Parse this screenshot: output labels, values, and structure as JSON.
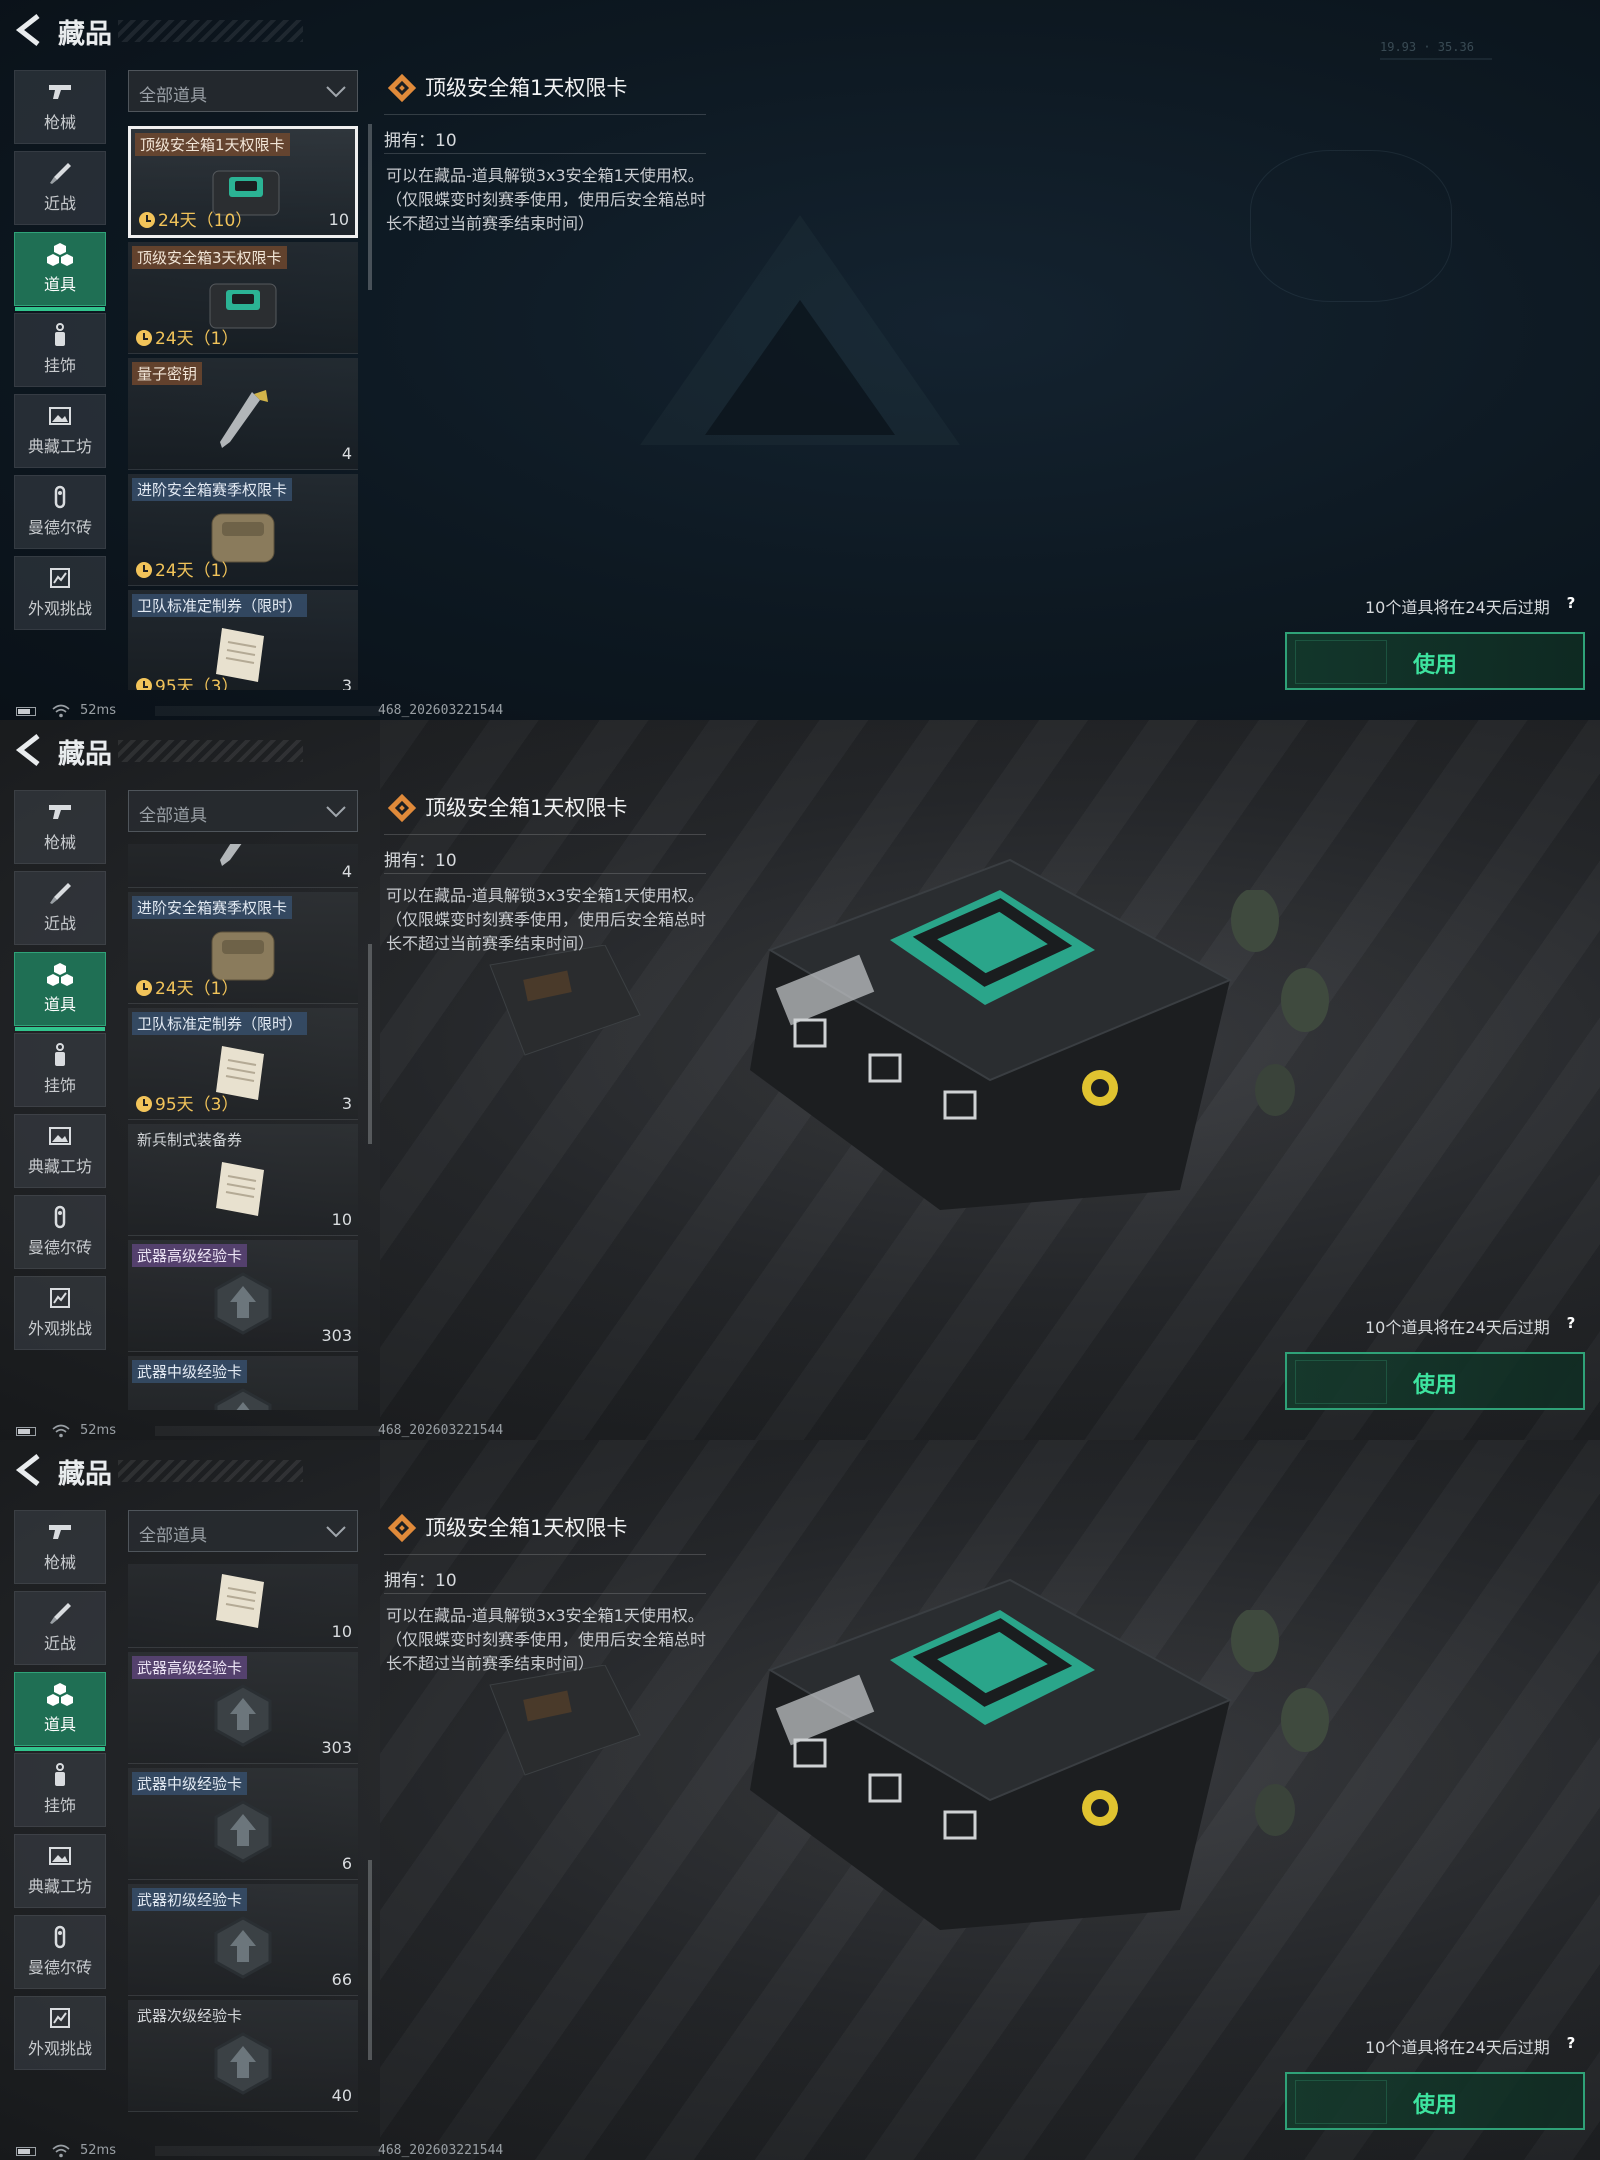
{
  "header": {
    "title": "藏品"
  },
  "nav": {
    "items": [
      {
        "label": "枪械",
        "icon": "pistol-icon"
      },
      {
        "label": "近战",
        "icon": "knife-icon"
      },
      {
        "label": "道具",
        "icon": "cubes-icon",
        "active": true
      },
      {
        "label": "挂饰",
        "icon": "charm-icon"
      },
      {
        "label": "典藏工坊",
        "icon": "gallery-icon"
      },
      {
        "label": "曼德尔砖",
        "icon": "brick-icon"
      },
      {
        "label": "外观挑战",
        "icon": "challenge-icon"
      }
    ]
  },
  "filter": {
    "selected": "全部道具"
  },
  "detail": {
    "title": "顶级安全箱1天权限卡",
    "owned": "拥有：10",
    "description": "可以在藏品-道具解锁3x3安全箱1天使用权。（仅限蝶变时刻赛季使用，使用后安全箱总时长不超过当前赛季结束时间）"
  },
  "expire_notice": "10个道具将在24天后过期",
  "help_label": "?",
  "use_button": "使用",
  "status": {
    "ping": "52ms",
    "build": "468_202603221544"
  },
  "hud": {
    "coords": "19.93 · 35.36"
  },
  "screens": [
    {
      "cards": [
        {
          "name": "顶级安全箱1天权限卡",
          "timer": "24天（10）",
          "count": "10",
          "thumb": "safe-case-thumb",
          "tag": "brown",
          "selected": true
        },
        {
          "name": "顶级安全箱3天权限卡",
          "timer": "24天（1）",
          "count": "",
          "thumb": "safe-case-thumb",
          "tag": "brown"
        },
        {
          "name": "量子密钥",
          "timer": "",
          "count": "4",
          "thumb": "key-thumb",
          "tag": "brown"
        },
        {
          "name": "进阶安全箱赛季权限卡",
          "timer": "24天（1）",
          "count": "",
          "thumb": "tan-case-thumb",
          "tag": "blue"
        },
        {
          "name": "卫队标准定制券（限时）",
          "timer": "95天（3）",
          "count": "3",
          "thumb": "paper-thumb",
          "tag": "blue"
        }
      ]
    },
    {
      "cards": [
        {
          "name": "",
          "timer": "",
          "count": "4",
          "thumb": "key-thumb",
          "tag": "plain"
        },
        {
          "name": "进阶安全箱赛季权限卡",
          "timer": "24天（1）",
          "count": "",
          "thumb": "tan-case-thumb",
          "tag": "blue"
        },
        {
          "name": "卫队标准定制券（限时）",
          "timer": "95天（3）",
          "count": "3",
          "thumb": "paper-thumb",
          "tag": "blue"
        },
        {
          "name": "新兵制式装备券",
          "timer": "",
          "count": "10",
          "thumb": "paper-thumb",
          "tag": "plain"
        },
        {
          "name": "武器高级经验卡",
          "timer": "",
          "count": "303",
          "thumb": "badge-thumb",
          "tag": "purple"
        },
        {
          "name": "武器中级经验卡",
          "timer": "",
          "count": "",
          "thumb": "badge-thumb",
          "tag": "blue"
        }
      ]
    },
    {
      "cards": [
        {
          "name": "",
          "timer": "",
          "count": "10",
          "thumb": "paper-thumb",
          "tag": "plain"
        },
        {
          "name": "武器高级经验卡",
          "timer": "",
          "count": "303",
          "thumb": "badge-thumb",
          "tag": "purple"
        },
        {
          "name": "武器中级经验卡",
          "timer": "",
          "count": "6",
          "thumb": "badge-thumb",
          "tag": "blue"
        },
        {
          "name": "武器初级经验卡",
          "timer": "",
          "count": "66",
          "thumb": "badge-thumb",
          "tag": "blue"
        },
        {
          "name": "武器次级经验卡",
          "timer": "",
          "count": "40",
          "thumb": "badge-thumb",
          "tag": "plain"
        }
      ]
    }
  ],
  "colors": {
    "accent": "#31c48d",
    "use_text": "#3de39f",
    "timer": "#f2c45a",
    "title_icon": "#e08a3a"
  }
}
